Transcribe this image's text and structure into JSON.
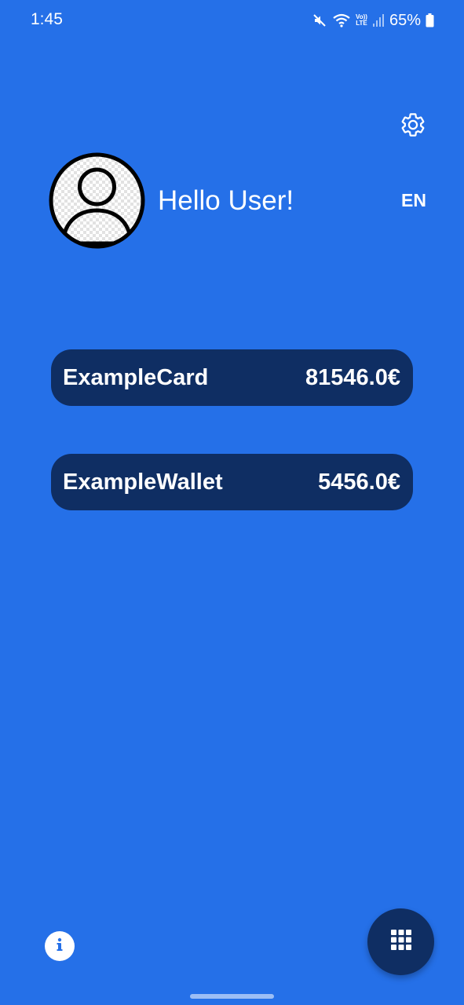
{
  "status_bar": {
    "time": "1:45",
    "battery_percent": "65%",
    "volte_top": "Vo))",
    "volte_bottom": "LTE",
    "icons": [
      "mute-icon",
      "wifi-icon",
      "volte-icon",
      "signal-icon",
      "battery-icon"
    ]
  },
  "header": {
    "greeting": "Hello User!",
    "language": "EN",
    "settings_icon": "gear-icon",
    "avatar_icon": "user-avatar-icon"
  },
  "accounts": [
    {
      "name": "ExampleCard",
      "balance": "81546.0€"
    },
    {
      "name": "ExampleWallet",
      "balance": "5456.0€"
    }
  ],
  "footer": {
    "info_icon": "info-icon",
    "menu_icon": "grid-menu-icon"
  },
  "colors": {
    "background": "#2570E8",
    "pill": "#0F2E63",
    "text": "#FFFFFF"
  }
}
